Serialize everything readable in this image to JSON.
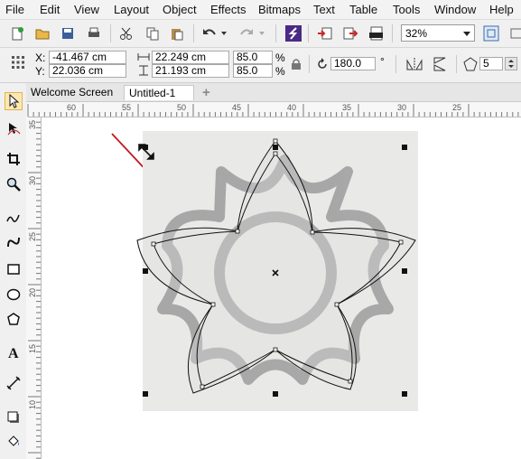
{
  "menu": [
    "File",
    "Edit",
    "View",
    "Layout",
    "Object",
    "Effects",
    "Bitmaps",
    "Text",
    "Table",
    "Tools",
    "Window",
    "Help"
  ],
  "toolbar": {
    "icons": [
      "new-document-icon",
      "open-icon",
      "save-icon",
      "print-icon",
      "cut-icon",
      "copy-icon",
      "paste-icon",
      "undo-icon",
      "redo-icon",
      "corel-connect-icon",
      "import-icon",
      "export-icon",
      "publish-pdf-icon"
    ],
    "zoom_value": "32%"
  },
  "property_bar": {
    "x_label": "X:",
    "x_value": "-41.467 cm",
    "y_label": "Y:",
    "y_value": "22.036 cm",
    "width_value": "22.249 cm",
    "height_value": "21.193 cm",
    "scale_x": "85.0",
    "scale_y": "85.0",
    "percent": "%",
    "rotation_value": "180.0",
    "degree": "°",
    "points_value": "5"
  },
  "tabs": {
    "welcome": "Welcome Screen",
    "document": "Untitled-1",
    "add": "+"
  },
  "rulers": {
    "horizontal": [
      "60",
      "55",
      "50",
      "45",
      "40",
      "35",
      "30",
      "25"
    ],
    "vertical": [
      "35",
      "30",
      "25",
      "20",
      "15",
      "10"
    ]
  },
  "colors": {
    "arrow": "#c0191b",
    "bitmap_bg": "#e9e9e7",
    "motif": "#9c9c9c"
  }
}
